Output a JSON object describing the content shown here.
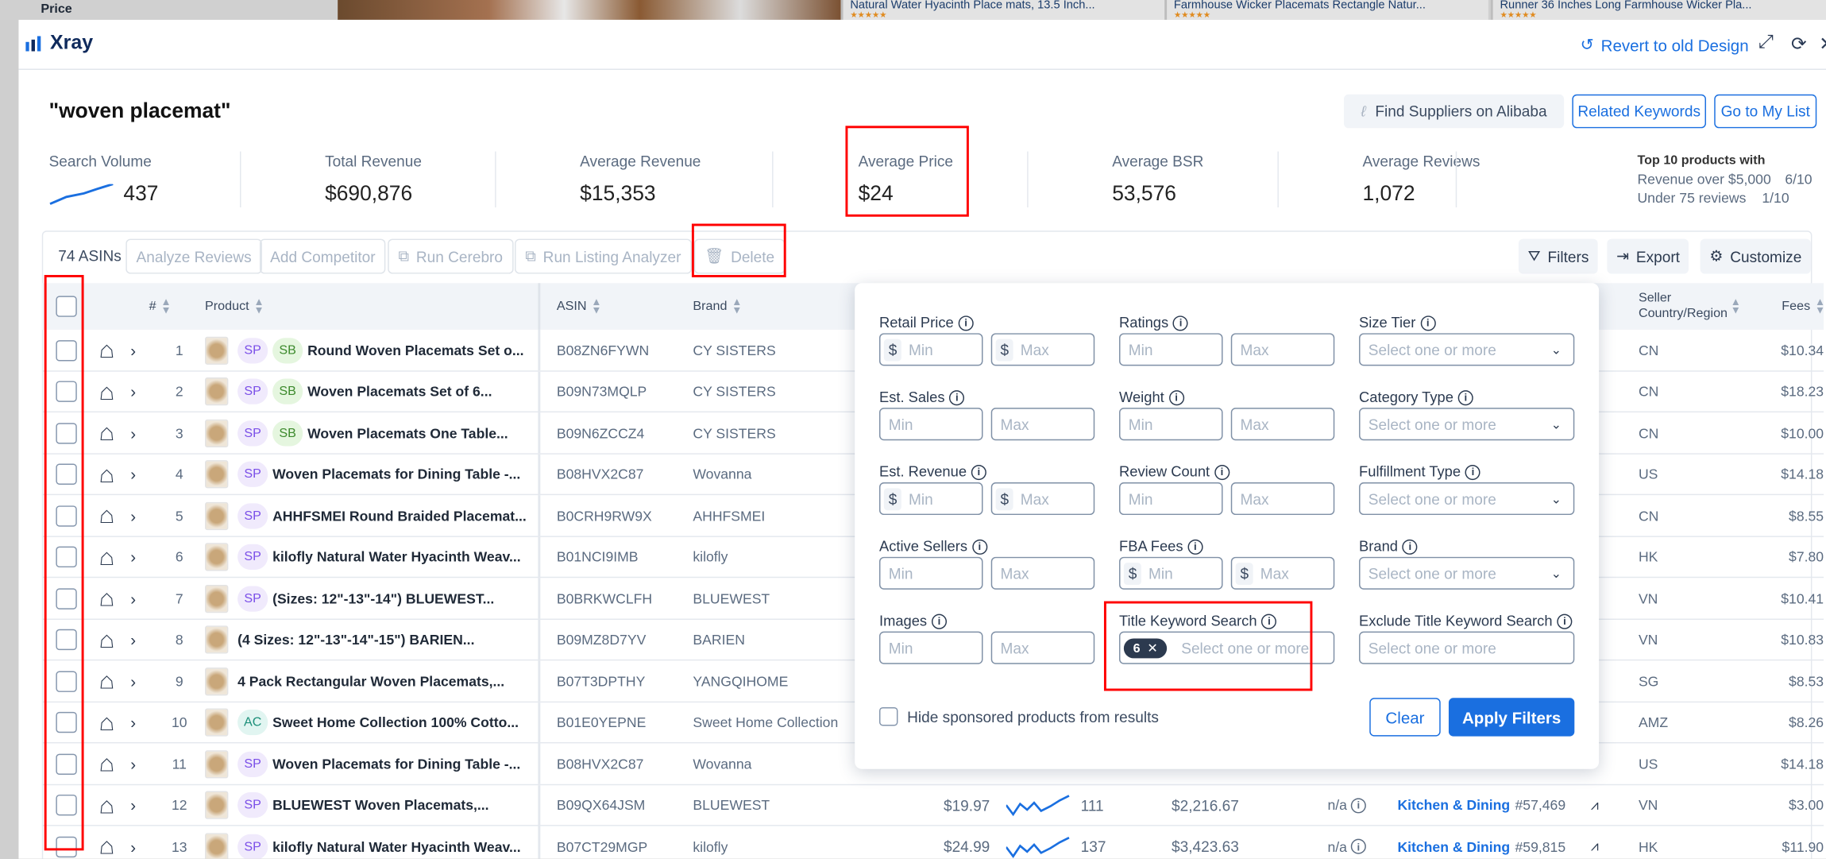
{
  "background": {
    "price_label": "Price",
    "cards": [
      {
        "title": "Natural Water Hyacinth Place mats, 13.5 Inch...",
        "stars": "★★★★★"
      },
      {
        "title": "Farmhouse Wicker Placemats Rectangle Natur...",
        "stars": "★★★★★"
      },
      {
        "title": "Runner 36 Inches Long Farmhouse Wicker Pla...",
        "stars": "★★★★★"
      }
    ]
  },
  "header": {
    "app_name": "Xray",
    "revert_label": "Revert to old Design"
  },
  "search": {
    "title": "\"woven placemat\""
  },
  "actions": {
    "alibaba": "Find Suppliers on Alibaba",
    "related": "Related Keywords",
    "my_list": "Go to My List"
  },
  "stats": [
    {
      "label": "Search Volume",
      "value": "437"
    },
    {
      "label": "Total Revenue",
      "value": "$690,876"
    },
    {
      "label": "Average Revenue",
      "value": "$15,353"
    },
    {
      "label": "Average Price",
      "value": "$24"
    },
    {
      "label": "Average BSR",
      "value": "53,576"
    },
    {
      "label": "Average Reviews",
      "value": "1,072"
    }
  ],
  "top10": {
    "heading": "Top 10 products with",
    "rev_label": "Revenue over $5,000",
    "rev_value": "6/10",
    "rev_label2": "Under 75 reviews",
    "rev_value2": "1/10"
  },
  "toolbar": {
    "count": "74 ASINs",
    "analyze": "Analyze Reviews",
    "competitor": "Add Competitor",
    "cerebro": "Run Cerebro",
    "listing": "Run Listing Analyzer",
    "delete": "Delete",
    "filters": "Filters",
    "export": "Export",
    "customize": "Customize"
  },
  "columns": {
    "num": "#",
    "product": "Product",
    "asin": "ASIN",
    "brand": "Brand",
    "seller_country": "Seller Country/Region",
    "fees": "Fees"
  },
  "rows": [
    {
      "num": "1",
      "badges": [
        "SP",
        "SB"
      ],
      "title": "Round Woven Placemats Set o...",
      "asin": "B08ZN6FYWN",
      "brand": "CY SISTERS",
      "country": "CN",
      "fees": "$10.34"
    },
    {
      "num": "2",
      "badges": [
        "SP",
        "SB"
      ],
      "title": "Woven Placemats Set of 6...",
      "asin": "B09N73MQLP",
      "brand": "CY SISTERS",
      "country": "CN",
      "fees": "$18.23"
    },
    {
      "num": "3",
      "badges": [
        "SP",
        "SB"
      ],
      "title": "Woven Placemats One Table...",
      "asin": "B09N6ZCCZ4",
      "brand": "CY SISTERS",
      "country": "CN",
      "fees": "$10.00"
    },
    {
      "num": "4",
      "badges": [
        "SP"
      ],
      "title": "Woven Placemats for Dining Table -...",
      "asin": "B08HVX2C87",
      "brand": "Wovanna",
      "country": "US",
      "fees": "$14.18"
    },
    {
      "num": "5",
      "badges": [
        "SP"
      ],
      "title": "AHHFSMEI Round Braided Placemat...",
      "asin": "B0CRH9RW9X",
      "brand": "AHHFSMEI",
      "country": "CN",
      "fees": "$8.55"
    },
    {
      "num": "6",
      "badges": [
        "SP"
      ],
      "title": "kilofly Natural Water Hyacinth Weav...",
      "asin": "B01NCI9IMB",
      "brand": "kilofly",
      "country": "HK",
      "fees": "$7.80"
    },
    {
      "num": "7",
      "badges": [
        "SP"
      ],
      "title": "(Sizes: 12\"-13\"-14\") BLUEWEST...",
      "asin": "B0BRKWCLFH",
      "brand": "BLUEWEST",
      "country": "VN",
      "fees": "$10.41"
    },
    {
      "num": "8",
      "badges": [],
      "title": "(4 Sizes: 12\"-13\"-14\"-15\") BARIEN...",
      "asin": "B09MZ8D7YV",
      "brand": "BARIEN",
      "country": "VN",
      "fees": "$10.83"
    },
    {
      "num": "9",
      "badges": [],
      "title": "4 Pack Rectangular Woven Placemats,...",
      "asin": "B07T3DPTHY",
      "brand": "YANGQIHOME",
      "country": "SG",
      "fees": "$8.53"
    },
    {
      "num": "10",
      "badges": [
        "AC"
      ],
      "title": "Sweet Home Collection 100% Cotto...",
      "asin": "B01E0YEPNE",
      "brand": "Sweet Home Collection",
      "country": "AMZ",
      "fees": "$8.26"
    },
    {
      "num": "11",
      "badges": [
        "SP"
      ],
      "title": "Woven Placemats for Dining Table -...",
      "asin": "B08HVX2C87",
      "brand": "Wovanna",
      "country": "US",
      "fees": "$14.18"
    },
    {
      "num": "12",
      "badges": [
        "SP"
      ],
      "title": "BLUEWEST Woven Placemats,...",
      "asin": "B09QX64JSM",
      "brand": "BLUEWEST",
      "country": "VN",
      "fees": "$3.00",
      "price": "$19.97",
      "sales": "111",
      "revenue": "$2,216.67",
      "na": "n/a",
      "category": "Kitchen & Dining",
      "bsr": "#57,469"
    },
    {
      "num": "13",
      "badges": [
        "SP"
      ],
      "title": "kilofly Natural Water Hyacinth Weav...",
      "asin": "B07CT29MGP",
      "brand": "kilofly",
      "country": "HK",
      "fees": "$11.90",
      "price": "$24.99",
      "sales": "137",
      "revenue": "$3,423.63",
      "na": "n/a",
      "category": "Kitchen & Dining",
      "bsr": "#59,815"
    }
  ],
  "filters": {
    "fields": [
      {
        "label": "Retail Price",
        "type": "range",
        "dollar": true,
        "min": "Min",
        "max": "Max"
      },
      {
        "label": "Ratings",
        "type": "range",
        "dollar": false,
        "min": "Min",
        "max": "Max"
      },
      {
        "label": "Size Tier",
        "type": "select",
        "placeholder": "Select one or more"
      },
      {
        "label": "Est. Sales",
        "type": "range",
        "dollar": false,
        "min": "Min",
        "max": "Max"
      },
      {
        "label": "Weight",
        "type": "range",
        "dollar": false,
        "min": "Min",
        "max": "Max"
      },
      {
        "label": "Category Type",
        "type": "select",
        "placeholder": "Select one or more"
      },
      {
        "label": "Est. Revenue",
        "type": "range",
        "dollar": true,
        "min": "Min",
        "max": "Max"
      },
      {
        "label": "Review Count",
        "type": "range",
        "dollar": false,
        "min": "Min",
        "max": "Max"
      },
      {
        "label": "Fulfillment Type",
        "type": "select",
        "placeholder": "Select one or more"
      },
      {
        "label": "Active Sellers",
        "type": "range",
        "dollar": false,
        "min": "Min",
        "max": "Max"
      },
      {
        "label": "FBA Fees",
        "type": "range",
        "dollar": true,
        "min": "Min",
        "max": "Max"
      },
      {
        "label": "Brand",
        "type": "select",
        "placeholder": "Select one or more"
      },
      {
        "label": "Images",
        "type": "range",
        "dollar": false,
        "min": "Min",
        "max": "Max"
      },
      {
        "label": "Title Keyword Search",
        "type": "tags",
        "chip": "6",
        "placeholder": "Select one or more"
      },
      {
        "label": "Exclude Title Keyword Search",
        "type": "text",
        "placeholder": "Select one or more"
      }
    ],
    "hide_sponsored": "Hide sponsored products from results",
    "hide_sponsored_checked": false,
    "clear": "Clear",
    "apply": "Apply Filters"
  },
  "colors": {
    "accent": "#1a6fe0",
    "annotation": "#ff0000"
  }
}
